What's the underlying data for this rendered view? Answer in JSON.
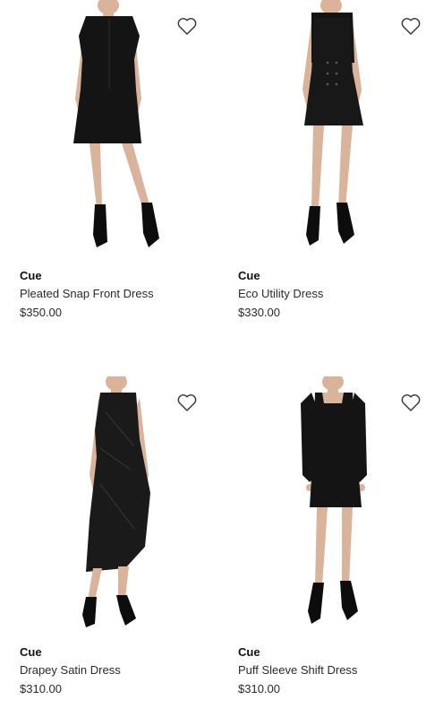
{
  "products": [
    {
      "brand": "Cue",
      "name": "Pleated Snap Front Dress",
      "price": "$350.00",
      "wishlist_icon": "heart-outline-icon"
    },
    {
      "brand": "Cue",
      "name": "Eco Utility Dress",
      "price": "$330.00",
      "wishlist_icon": "heart-outline-icon"
    },
    {
      "brand": "Cue",
      "name": "Drapey Satin Dress",
      "price": "$310.00",
      "wishlist_icon": "heart-outline-icon"
    },
    {
      "brand": "Cue",
      "name": "Puff Sleeve Shift Dress",
      "price": "$310.00",
      "wishlist_icon": "heart-outline-icon"
    }
  ],
  "colors": {
    "dress": "#141414",
    "skin": "#d9b39a",
    "boots": "#0d0d0d",
    "text": "#1f1f1f"
  }
}
